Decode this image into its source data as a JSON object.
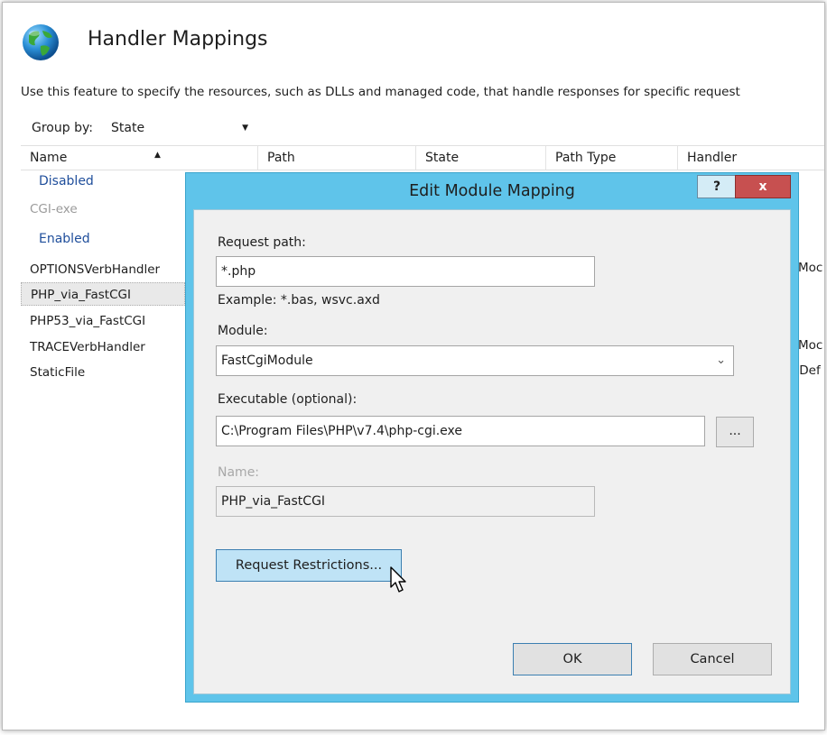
{
  "page": {
    "title": "Handler Mappings",
    "description": "Use this feature to specify the resources, such as DLLs and managed code, that handle responses for specific request",
    "icon": "globe-icon"
  },
  "groupby": {
    "label": "Group by:",
    "value": "State"
  },
  "list": {
    "columns": [
      "Name",
      "Path",
      "State",
      "Path Type",
      "Handler"
    ],
    "groups": {
      "disabled": "Disabled",
      "enabled": "Enabled"
    },
    "disabled_rows": [
      "CGI-exe"
    ],
    "enabled_rows": [
      "OPTIONSVerbHandler",
      "PHP_via_FastCGI",
      "PHP53_via_FastCGI",
      "TRACEVerbHandler",
      "StaticFile"
    ],
    "trailing": [
      "Moc",
      "Moc",
      ",Def"
    ]
  },
  "dialog": {
    "title": "Edit Module Mapping",
    "help_label": "?",
    "close_label": "x",
    "request_path_label": "Request path:",
    "request_path_value": "*.php",
    "example_text": "Example: *.bas, wsvc.axd",
    "module_label": "Module:",
    "module_value": "FastCgiModule",
    "executable_label": "Executable (optional):",
    "executable_value": "C:\\Program Files\\PHP\\v7.4\\php-cgi.exe",
    "browse_label": "...",
    "name_label": "Name:",
    "name_value": "PHP_via_FastCGI",
    "restrictions_label": "Request Restrictions...",
    "ok_label": "OK",
    "cancel_label": "Cancel"
  },
  "colors": {
    "dialog_frame": "#5fc4ea",
    "close_button": "#c75050",
    "group_label": "#1f4e9b"
  }
}
